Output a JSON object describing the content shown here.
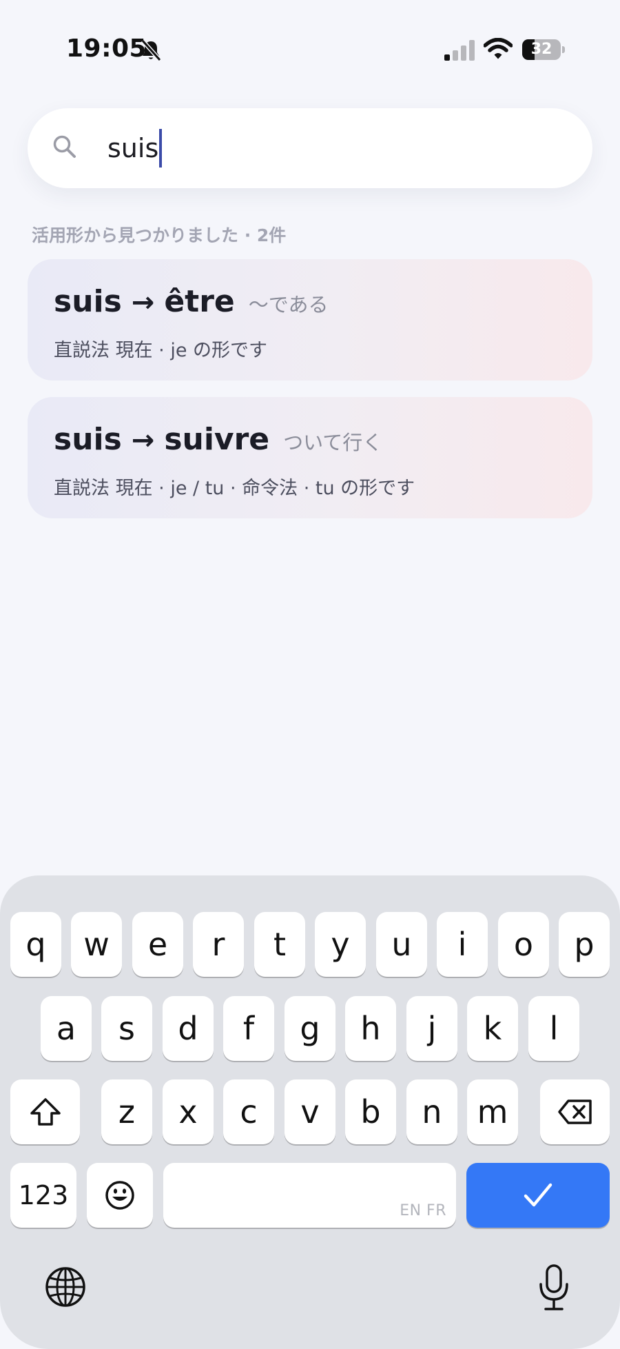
{
  "status": {
    "time": "19:05",
    "battery_level": "32",
    "battery_fraction": 0.32,
    "icons": [
      "bell-slash-icon",
      "cellular-signal-icon",
      "wifi-icon",
      "battery-icon"
    ]
  },
  "search": {
    "value": "suis",
    "icon": "search-icon"
  },
  "results": {
    "summary": "活用形から見つかりました · 2件",
    "items": [
      {
        "form": "suis",
        "arrow": "→",
        "lemma": "être",
        "meaning": "〜である",
        "description": "直説法 現在 · je の形です"
      },
      {
        "form": "suis",
        "arrow": "→",
        "lemma": "suivre",
        "meaning": "ついて行く",
        "description": "直説法 現在 · je / tu · 命令法 · tu の形です"
      }
    ]
  },
  "keyboard": {
    "row1": [
      "q",
      "w",
      "e",
      "r",
      "t",
      "y",
      "u",
      "i",
      "o",
      "p"
    ],
    "row2": [
      "a",
      "s",
      "d",
      "f",
      "g",
      "h",
      "j",
      "k",
      "l"
    ],
    "row3": [
      "z",
      "x",
      "c",
      "v",
      "b",
      "n",
      "m"
    ],
    "numbers_label": "123",
    "space_languages": "EN FR",
    "icons": {
      "shift": "shift-icon",
      "delete": "backspace-icon",
      "emoji": "emoji-icon",
      "done": "checkmark-icon",
      "globe": "globe-icon",
      "mic": "microphone-icon"
    },
    "accent_color": "#3478f6"
  }
}
